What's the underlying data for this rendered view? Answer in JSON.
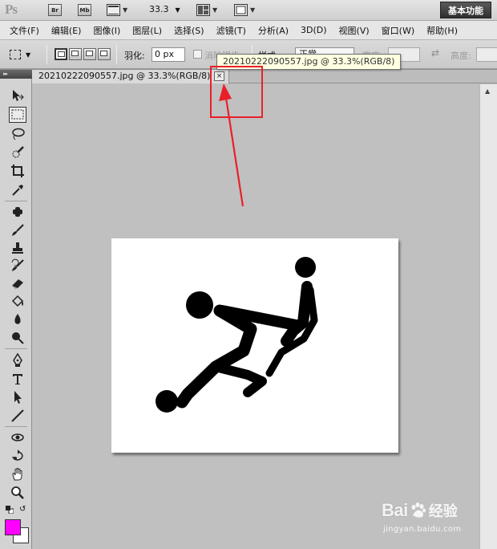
{
  "app": {
    "logo": "Ps",
    "bridge_label": "Br",
    "minibridge_label": "Mb",
    "zoom_value": "33.3",
    "workspace_label": "基本功能"
  },
  "menu": [
    "文件(F)",
    "编辑(E)",
    "图像(I)",
    "图层(L)",
    "选择(S)",
    "滤镜(T)",
    "分析(A)",
    "3D(D)",
    "视图(V)",
    "窗口(W)",
    "帮助(H)"
  ],
  "options": {
    "feather_label": "羽化:",
    "feather_value": "0 px",
    "antialias_label": "消除锯齿",
    "style_label": "样式:",
    "style_value": "正常",
    "width_label": "宽度:",
    "height_label": "高度:"
  },
  "tooltip": "20210222090557.jpg @ 33.3%(RGB/8)",
  "document": {
    "tab_title": "20210222090557.jpg @ 33.3%(RGB/8)",
    "close_glyph": "×"
  },
  "colors": {
    "foreground": "#ff00ff",
    "background": "#ffffff",
    "annotation": "#e8202a"
  },
  "tools": [
    "move-icon",
    "rectangular-marquee-icon",
    "lasso-icon",
    "quick-selection-icon",
    "crop-icon",
    "eyedropper-icon",
    "spot-healing-icon",
    "brush-icon",
    "clone-stamp-icon",
    "history-brush-icon",
    "eraser-icon",
    "paint-bucket-icon",
    "blur-icon",
    "dodge-icon",
    "pen-icon",
    "type-icon",
    "path-selection-icon",
    "line-icon",
    "3d-rotate-icon",
    "3d-orbit-icon",
    "hand-icon",
    "zoom-icon"
  ],
  "watermark": {
    "brand_a": "Bai",
    "brand_b": "经验",
    "url": "jingyan.baidu.com"
  }
}
